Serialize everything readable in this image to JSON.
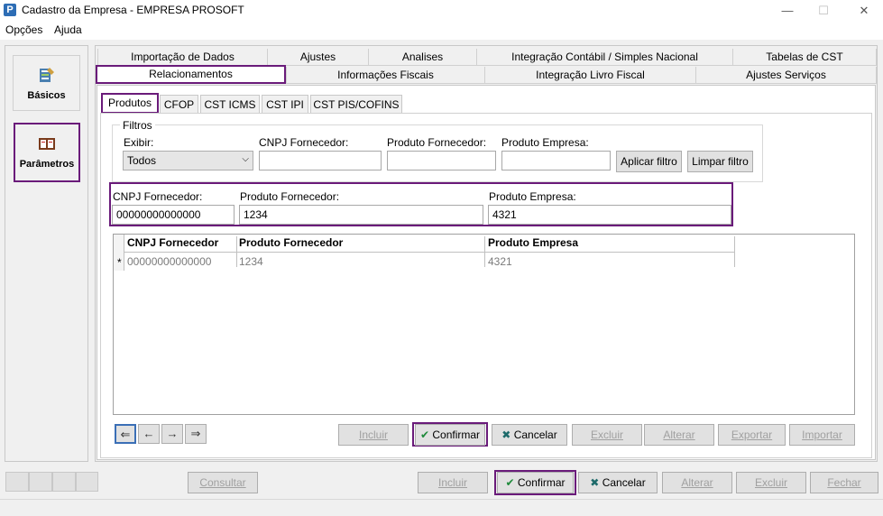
{
  "window": {
    "app_icon": "P",
    "title": "Cadastro da Empresa - EMPRESA PROSOFT",
    "minimize": "—",
    "maximize": "☐",
    "close": "✕"
  },
  "menu": [
    "Opções",
    "Ajuda"
  ],
  "sidebar": [
    {
      "label": "Básicos",
      "icon": "basicos-icon"
    },
    {
      "label": "Parâmetros",
      "icon": "parametros-icon"
    }
  ],
  "tabs_row1": [
    "Importação de Dados",
    "Ajustes",
    "Analises",
    "Integração Contábil / Simples Nacional",
    "Tabelas de CST"
  ],
  "tabs_row2": [
    "Relacionamentos",
    "Informações Fiscais",
    "Integração Livro Fiscal",
    "Ajustes Serviços"
  ],
  "subtabs": [
    "Produtos",
    "CFOP",
    "CST ICMS",
    "CST IPI",
    "CST PIS/COFINS"
  ],
  "filters": {
    "legend": "Filtros",
    "exibir_label": "Exibir:",
    "exibir_value": "Todos",
    "cnpj_label": "CNPJ Fornecedor:",
    "cnpj_value": "",
    "prodforn_label": "Produto Fornecedor:",
    "prodforn_value": "",
    "prodemp_label": "Produto Empresa:",
    "prodemp_value": "",
    "apply": "Aplicar filtro",
    "clear": "Limpar filtro"
  },
  "edit": {
    "cnpj_label": "CNPJ Fornecedor:",
    "cnpj_value": "00000000000000",
    "prodforn_label": "Produto Fornecedor:",
    "prodforn_value": "1234",
    "prodemp_label": "Produto Empresa:",
    "prodemp_value": "4321"
  },
  "grid": {
    "headers": [
      "CNPJ Fornecedor",
      "Produto Fornecedor",
      "Produto Empresa"
    ],
    "rows": [
      {
        "marker": "*",
        "cells": [
          "00000000000000",
          "1234",
          "4321"
        ]
      }
    ]
  },
  "nav": [
    "⇐",
    "←",
    "→",
    "⇒"
  ],
  "inner_actions": {
    "incluir": "Incluir",
    "confirmar": "Confirmar",
    "cancelar": "Cancelar",
    "excluir": "Excluir",
    "alterar": "Alterar",
    "exportar": "Exportar",
    "importar": "Importar"
  },
  "bottom_actions": {
    "consultar": "Consultar",
    "incluir": "Incluir",
    "confirmar": "Confirmar",
    "cancelar": "Cancelar",
    "alterar": "Alterar",
    "excluir": "Excluir",
    "fechar": "Fechar"
  },
  "colors": {
    "highlight": "#6a1b7a",
    "confirm": "#1e8a3a"
  }
}
